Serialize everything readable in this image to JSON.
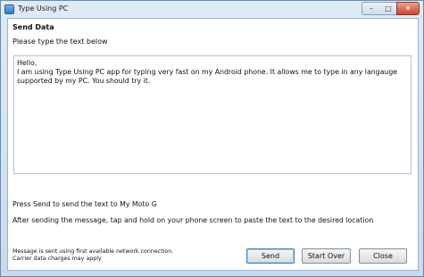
{
  "window": {
    "title": "Type Using PC"
  },
  "caption_buttons": {
    "minimize": "–",
    "maximize": "□",
    "close": "✕"
  },
  "main": {
    "heading": "Send Data",
    "subheading": "Please type the text below",
    "message_text": "Hello,\nI am using Type Using PC app for typing very fast on my Android phone. It allows me to type in any langauge supported by my PC. You should try it.",
    "send_info": "Press Send to send the text to My Moto G",
    "paste_info": "After sending the message, tap and hold on your phone screen to paste the text to the desired location"
  },
  "footer": {
    "note_line1": "Message is sent using first available network connection.",
    "note_line2": "Carrier data charges may apply",
    "send_label": "Send",
    "start_over_label": "Start Over",
    "close_label": "Close"
  },
  "icons": {
    "app": "app-icon"
  }
}
